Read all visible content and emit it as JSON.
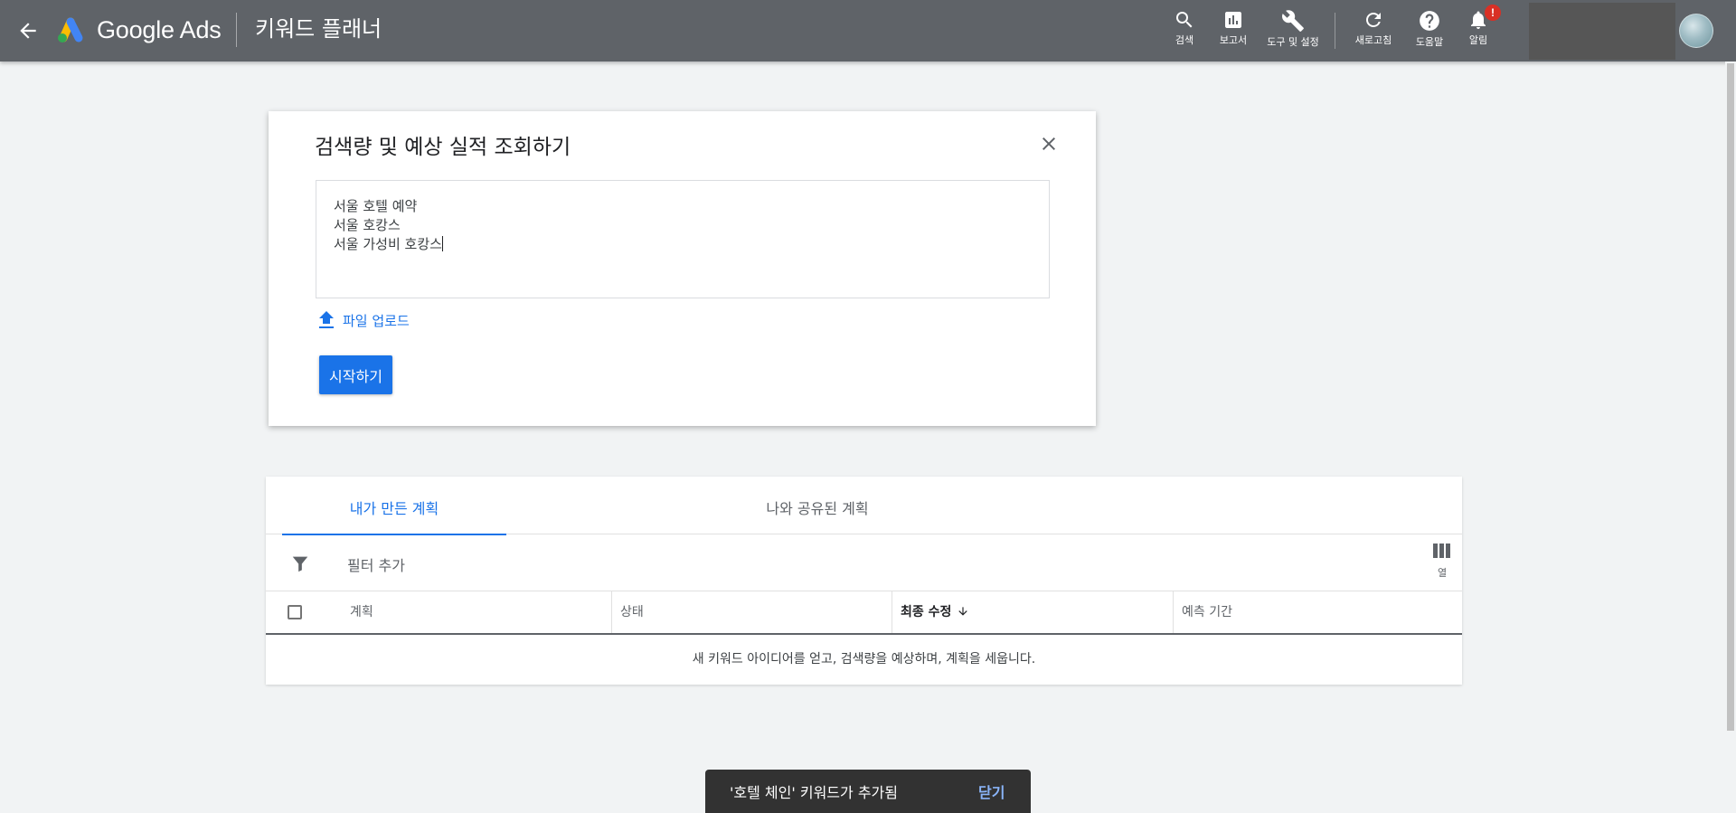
{
  "header": {
    "brand": "Google Ads",
    "title": "키워드 플래너",
    "tools": [
      {
        "label": "검색",
        "icon": "search-icon"
      },
      {
        "label": "보고서",
        "icon": "reports-icon"
      },
      {
        "label": "도구 및 설정",
        "icon": "wrench-icon"
      },
      {
        "label": "새로고침",
        "icon": "refresh-icon"
      },
      {
        "label": "도움말",
        "icon": "help-icon"
      },
      {
        "label": "알림",
        "icon": "bell-icon"
      }
    ],
    "notification_badge": "!"
  },
  "forecast_card": {
    "title": "검색량 및 예상 실적 조회하기",
    "keywords": [
      "서울 호텔 예약",
      "서울 호캉스",
      "서울 가성비 호캉스"
    ],
    "upload_label": "파일 업로드",
    "start_label": "시작하기"
  },
  "plans": {
    "tabs": [
      {
        "label": "내가 만든 계획",
        "active": true
      },
      {
        "label": "나와 공유된 계획",
        "active": false
      }
    ],
    "filter_label": "필터 추가",
    "columns_label": "열",
    "columns": [
      "계획",
      "상태",
      "최종 수정",
      "예측 기간"
    ],
    "sorted_column": "최종 수정",
    "empty_message": "새 키워드 아이디어를 얻고, 검색량을 예상하며, 계획을 세웁니다."
  },
  "snackbar": {
    "message": "'호텔 체인' 키워드가 추가됨",
    "action": "닫기"
  },
  "colors": {
    "topbar": "#5f6368",
    "accent": "#1a73e8",
    "background": "#f1f3f4",
    "badge": "#d93025"
  }
}
